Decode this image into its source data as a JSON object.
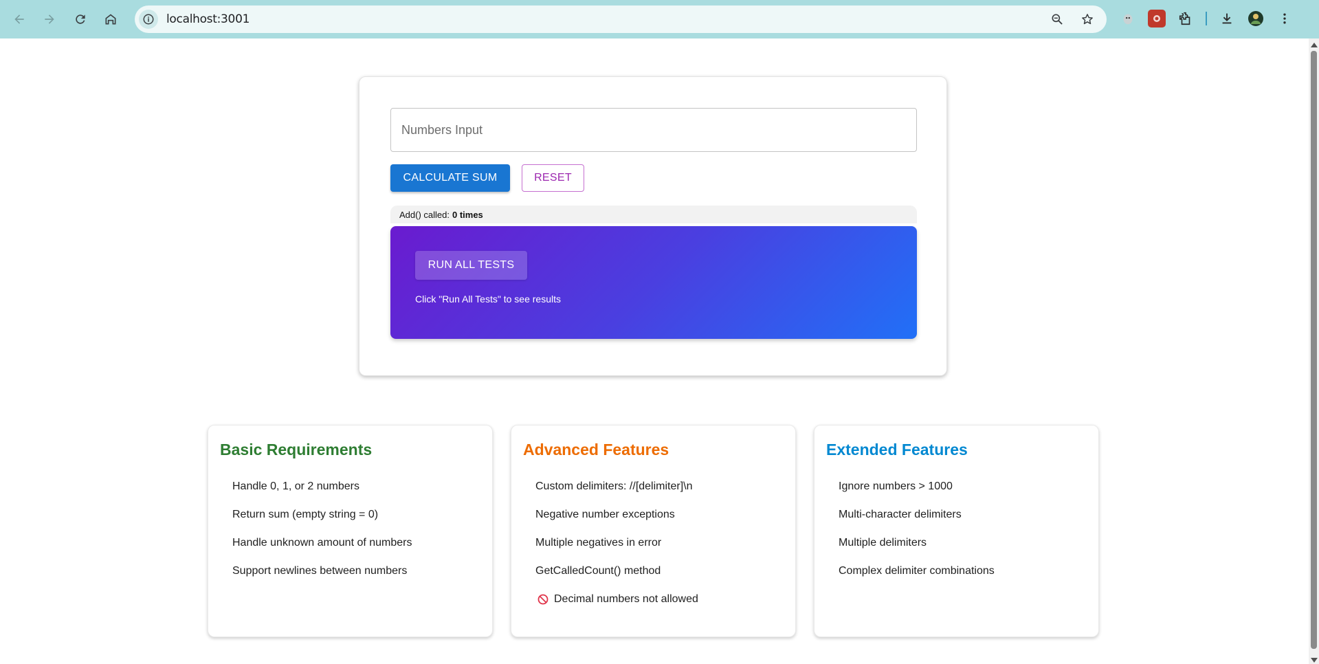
{
  "browser": {
    "url": "localhost:3001"
  },
  "main": {
    "input_placeholder": "Numbers Input",
    "input_value": "",
    "calculate_label": "CALCULATE SUM",
    "reset_label": "RESET",
    "counter_prefix": "Add() called:",
    "counter_value": "0 times",
    "run_tests_label": "RUN ALL TESTS",
    "tests_hint": "Click \"Run All Tests\" to see results"
  },
  "features": [
    {
      "title": "Basic Requirements",
      "color": "#2e7d32",
      "items": [
        "Handle 0, 1, or 2 numbers",
        "Return sum (empty string = 0)",
        "Handle unknown amount of numbers",
        "Support newlines between numbers"
      ]
    },
    {
      "title": "Advanced Features",
      "color": "#ed6c02",
      "items": [
        "Custom delimiters: //[delimiter]\\n",
        "Negative number exceptions",
        "Multiple negatives in error",
        "GetCalledCount() method",
        "Decimal numbers not allowed"
      ]
    },
    {
      "title": "Extended Features",
      "color": "#0288d1",
      "items": [
        "Ignore numbers > 1000",
        "Multi-character delimiters",
        "Multiple delimiters",
        "Complex delimiter combinations"
      ]
    }
  ],
  "colors": {
    "primary": "#1976d2",
    "secondary": "#9c27b0",
    "gradient_start": "#6a1bcf",
    "gradient_end": "#2170f7",
    "chrome": "#a9dcdf"
  }
}
